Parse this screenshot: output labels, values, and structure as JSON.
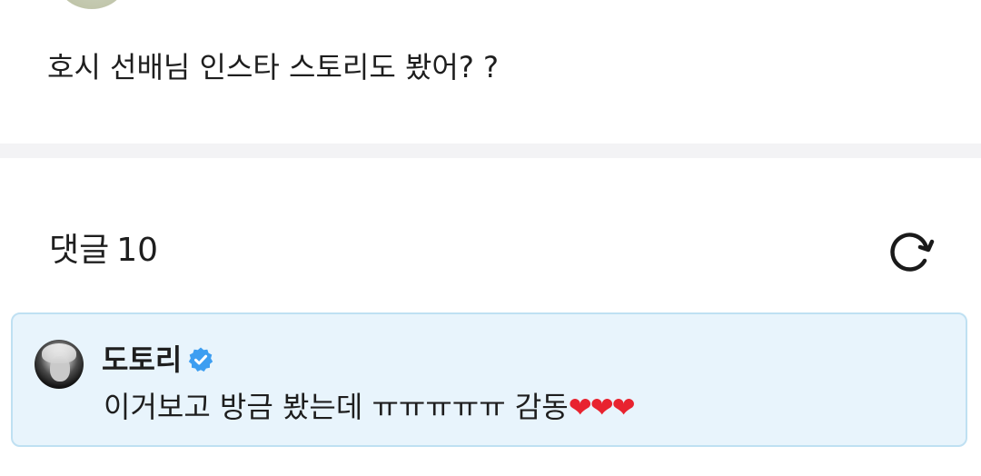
{
  "post": {
    "body": "호시 선배님 인스타 스토리도 봤어? ?"
  },
  "comments": {
    "label": "댓글",
    "count": "10",
    "refresh_icon": "refresh-icon"
  },
  "comment": {
    "author": "도토리",
    "verified_icon": "verified-badge-icon",
    "text": "이거보고 방금 봤는데 ㅠㅠㅠㅠㅠ 감동",
    "hearts": "❤❤❤"
  },
  "colors": {
    "highlight_background": "#e8f4fc",
    "highlight_border": "#bfe0f2",
    "verified_blue": "#3d9ef1",
    "divider": "#f3f3f5"
  }
}
